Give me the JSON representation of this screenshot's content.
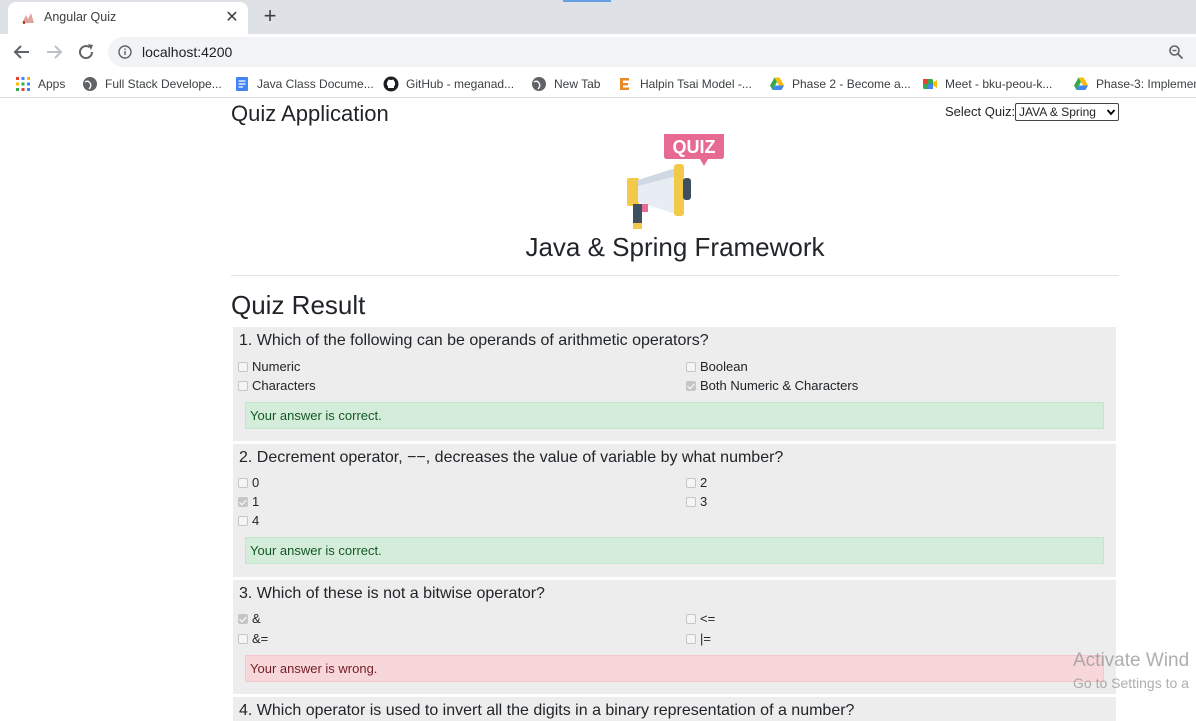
{
  "browser": {
    "tab": {
      "title": "Angular Quiz",
      "close_glyph": "✕"
    },
    "new_tab_glyph": "+",
    "url": "localhost:4200",
    "bookmarks": [
      {
        "label": "Apps",
        "icon": "apps-grid-icon"
      },
      {
        "label": "Full Stack Develope...",
        "icon": "globe-icon"
      },
      {
        "label": "Java Class Docume...",
        "icon": "document-icon"
      },
      {
        "label": "GitHub - meganad...",
        "icon": "github-icon"
      },
      {
        "label": "New Tab",
        "icon": "globe-icon"
      },
      {
        "label": "Halpin Tsai Model -...",
        "icon": "letter-e-icon"
      },
      {
        "label": "Phase 2 - Become a...",
        "icon": "google-drive-icon"
      },
      {
        "label": "Meet - bku-peou-k...",
        "icon": "google-meet-icon"
      },
      {
        "label": "Phase-3: Implemen",
        "icon": "google-drive-icon"
      }
    ]
  },
  "app": {
    "title": "Quiz Application",
    "select_label": "Select Quiz:",
    "select_value": "JAVA & Spring",
    "logo_text": "QUIZ",
    "quiz_name": "Java & Spring Framework",
    "result_title": "Quiz Result"
  },
  "questions": [
    {
      "text": "1. Which of the following can be operands of arithmetic operators?",
      "options": [
        {
          "label": "Numeric",
          "checked": false
        },
        {
          "label": "Boolean",
          "checked": false
        },
        {
          "label": "Characters",
          "checked": false
        },
        {
          "label": "Both Numeric & Characters",
          "checked": true
        }
      ],
      "result": "Your answer is correct.",
      "status": "correct"
    },
    {
      "text": "2. Decrement operator, −−, decreases the value of variable by what number?",
      "options": [
        {
          "label": "0",
          "checked": false
        },
        {
          "label": "2",
          "checked": false
        },
        {
          "label": "1",
          "checked": true
        },
        {
          "label": "3",
          "checked": false
        },
        {
          "label": "4",
          "checked": false
        }
      ],
      "result": "Your answer is correct.",
      "status": "correct"
    },
    {
      "text": "3. Which of these is not a bitwise operator?",
      "options": [
        {
          "label": "&",
          "checked": true
        },
        {
          "label": "<=",
          "checked": false
        },
        {
          "label": "&=",
          "checked": false
        },
        {
          "label": "|=",
          "checked": false
        }
      ],
      "result": "Your answer is wrong.",
      "status": "wrong"
    },
    {
      "text": "4. Which operator is used to invert all the digits in a binary representation of a number?"
    }
  ],
  "watermark": {
    "line1": "Activate Wind",
    "line2": "Go to Settings to a"
  },
  "colors": {
    "correct_bg": "#d4edda",
    "wrong_bg": "#f8d7da",
    "card_bg": "#ededed"
  }
}
